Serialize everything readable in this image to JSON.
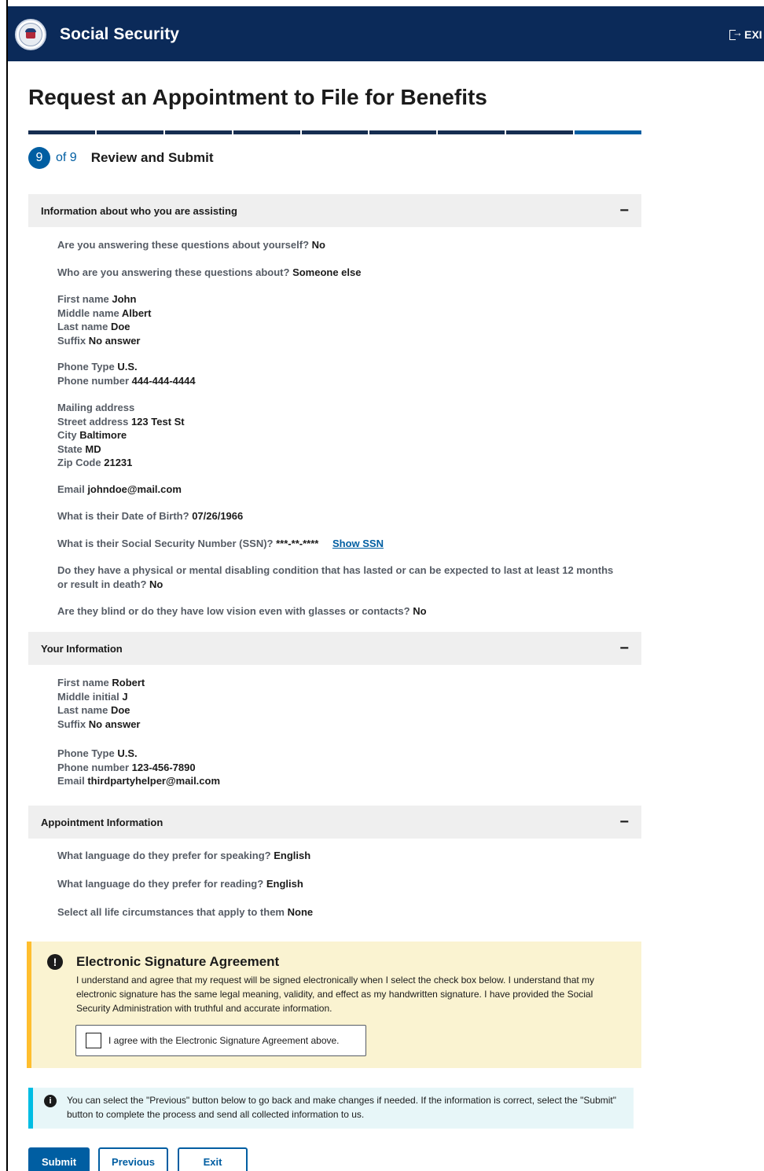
{
  "header": {
    "brand": "Social Security",
    "exit_label": "EXI"
  },
  "page_title": "Request an Appointment to File for Benefits",
  "progress": {
    "current_step": 9,
    "total_steps": 9
  },
  "step": {
    "number": "9",
    "of": "of 9",
    "title": "Review and Submit"
  },
  "sections": {
    "assisting": {
      "title": "Information about who you are assisting",
      "toggle": "−",
      "about_self_q": "Are you answering these questions about yourself?",
      "about_self_a": "No",
      "who_q": "Who are you answering these questions about?",
      "who_a": "Someone else",
      "first_name_l": "First name",
      "first_name_v": "John",
      "middle_name_l": "Middle name",
      "middle_name_v": "Albert",
      "last_name_l": "Last name",
      "last_name_v": "Doe",
      "suffix_l": "Suffix",
      "suffix_v": "No answer",
      "phone_type_l": "Phone Type",
      "phone_type_v": "U.S.",
      "phone_number_l": "Phone number",
      "phone_number_v": "444-444-4444",
      "mailing_l": "Mailing address",
      "street_l": "Street address",
      "street_v": "123 Test St",
      "city_l": "City",
      "city_v": "Baltimore",
      "state_l": "State",
      "state_v": "MD",
      "zip_l": "Zip Code",
      "zip_v": "21231",
      "email_l": "Email",
      "email_v": "johndoe@mail.com",
      "dob_q": "What is their Date of Birth?",
      "dob_a": "07/26/1966",
      "ssn_q": "What is their Social Security Number (SSN)?",
      "ssn_a": "***-**-****",
      "show_ssn": "Show SSN",
      "disability_q": "Do they have a physical or mental disabling condition that has lasted or can be expected to last at least 12 months or result in death?",
      "disability_a": "No",
      "blind_q": "Are they blind or do they have low vision even with glasses or contacts?",
      "blind_a": "No"
    },
    "your_info": {
      "title": "Your Information",
      "toggle": "−",
      "first_name_l": "First name",
      "first_name_v": "Robert",
      "middle_initial_l": "Middle initial",
      "middle_initial_v": "J",
      "last_name_l": "Last name",
      "last_name_v": "Doe",
      "suffix_l": "Suffix",
      "suffix_v": "No answer",
      "phone_type_l": "Phone Type",
      "phone_type_v": "U.S.",
      "phone_number_l": "Phone number",
      "phone_number_v": "123-456-7890",
      "email_l": "Email",
      "email_v": "thirdpartyhelper@mail.com"
    },
    "appointment": {
      "title": "Appointment Information",
      "toggle": "−",
      "speaking_q": "What language do they prefer for speaking?",
      "speaking_a": "English",
      "reading_q": "What language do they prefer for reading?",
      "reading_a": "English",
      "circumstances_q": "Select all life circumstances that apply to them",
      "circumstances_a": "None"
    }
  },
  "signature": {
    "icon": "!",
    "title": "Electronic Signature Agreement",
    "body": "I understand and agree that my request will be signed electronically when I select the check box below. I understand that my electronic signature has the same legal meaning, validity, and effect as my handwritten signature. I have provided the Social Security Administration with truthful and accurate information.",
    "checkbox_label": "I agree with the Electronic Signature Agreement above.",
    "checked": false
  },
  "note": {
    "icon": "i",
    "text": "You can select the \"Previous\" button below to go back and make changes if needed. If the information is correct, select the \"Submit\" button to complete the process and send all collected information to us."
  },
  "buttons": {
    "submit": "Submit",
    "previous": "Previous",
    "exit": "Exit"
  },
  "colors": {
    "header_bg": "#0b2a59",
    "primary": "#005ea2",
    "section_bg": "#efefef",
    "warning_bg": "#faf3d1",
    "warning_border": "#ffbe2e",
    "info_bg": "#e7f6f8",
    "info_border": "#00bde3"
  }
}
